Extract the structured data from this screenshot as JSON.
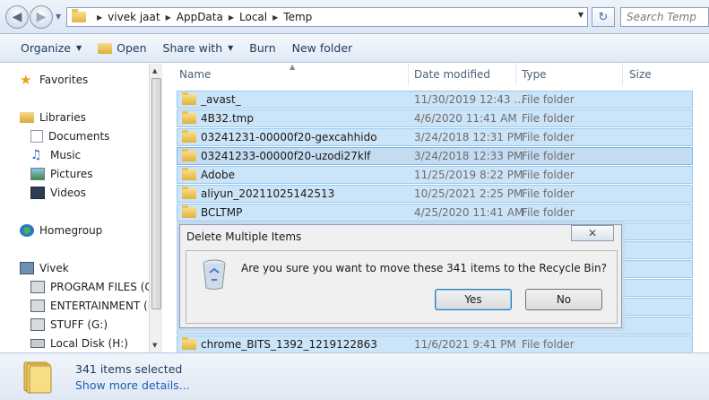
{
  "address": {
    "crumbs": [
      "vivek jaat",
      "AppData",
      "Local",
      "Temp"
    ],
    "search_placeholder": "Search Temp"
  },
  "toolbar": {
    "organize": "Organize",
    "open": "Open",
    "share_with": "Share with",
    "burn": "Burn",
    "new_folder": "New folder"
  },
  "nav": {
    "favorites": "Favorites",
    "libraries": "Libraries",
    "documents": "Documents",
    "music": "Music",
    "pictures": "Pictures",
    "videos": "Videos",
    "homegroup": "Homegroup",
    "computer": "Vivek",
    "drive_c": "PROGRAM FILES (C:)",
    "drive_d": "ENTERTAINMENT (D",
    "drive_g": "STUFF (G:)",
    "drive_h": "Local Disk (H:)"
  },
  "columns": {
    "name": "Name",
    "date": "Date modified",
    "type": "Type",
    "size": "Size"
  },
  "files": [
    {
      "name": "_avast_",
      "date": "11/30/2019 12:43 ...",
      "type": "File folder"
    },
    {
      "name": "4B32.tmp",
      "date": "4/6/2020 11:41 AM",
      "type": "File folder"
    },
    {
      "name": "03241231-00000f20-gexcahhido",
      "date": "3/24/2018 12:31 PM",
      "type": "File folder"
    },
    {
      "name": "03241233-00000f20-uzodi27klf",
      "date": "3/24/2018 12:33 PM",
      "type": "File folder"
    },
    {
      "name": "Adobe",
      "date": "11/25/2019 8:22 PM",
      "type": "File folder"
    },
    {
      "name": "aliyun_20211025142513",
      "date": "10/25/2021 2:25 PM",
      "type": "File folder"
    },
    {
      "name": "BCLTMP",
      "date": "4/25/2020 11:41 AM",
      "type": "File folder"
    },
    {
      "name": "chrome_BITS_1392_1219122863",
      "date": "11/6/2021 9:41 PM",
      "type": "File folder"
    }
  ],
  "status": {
    "count": "341 items selected",
    "more": "Show more details..."
  },
  "dialog": {
    "title": "Delete Multiple Items",
    "message": "Are you sure you want to move these 341 items to the Recycle Bin?",
    "yes": "Yes",
    "no": "No"
  }
}
